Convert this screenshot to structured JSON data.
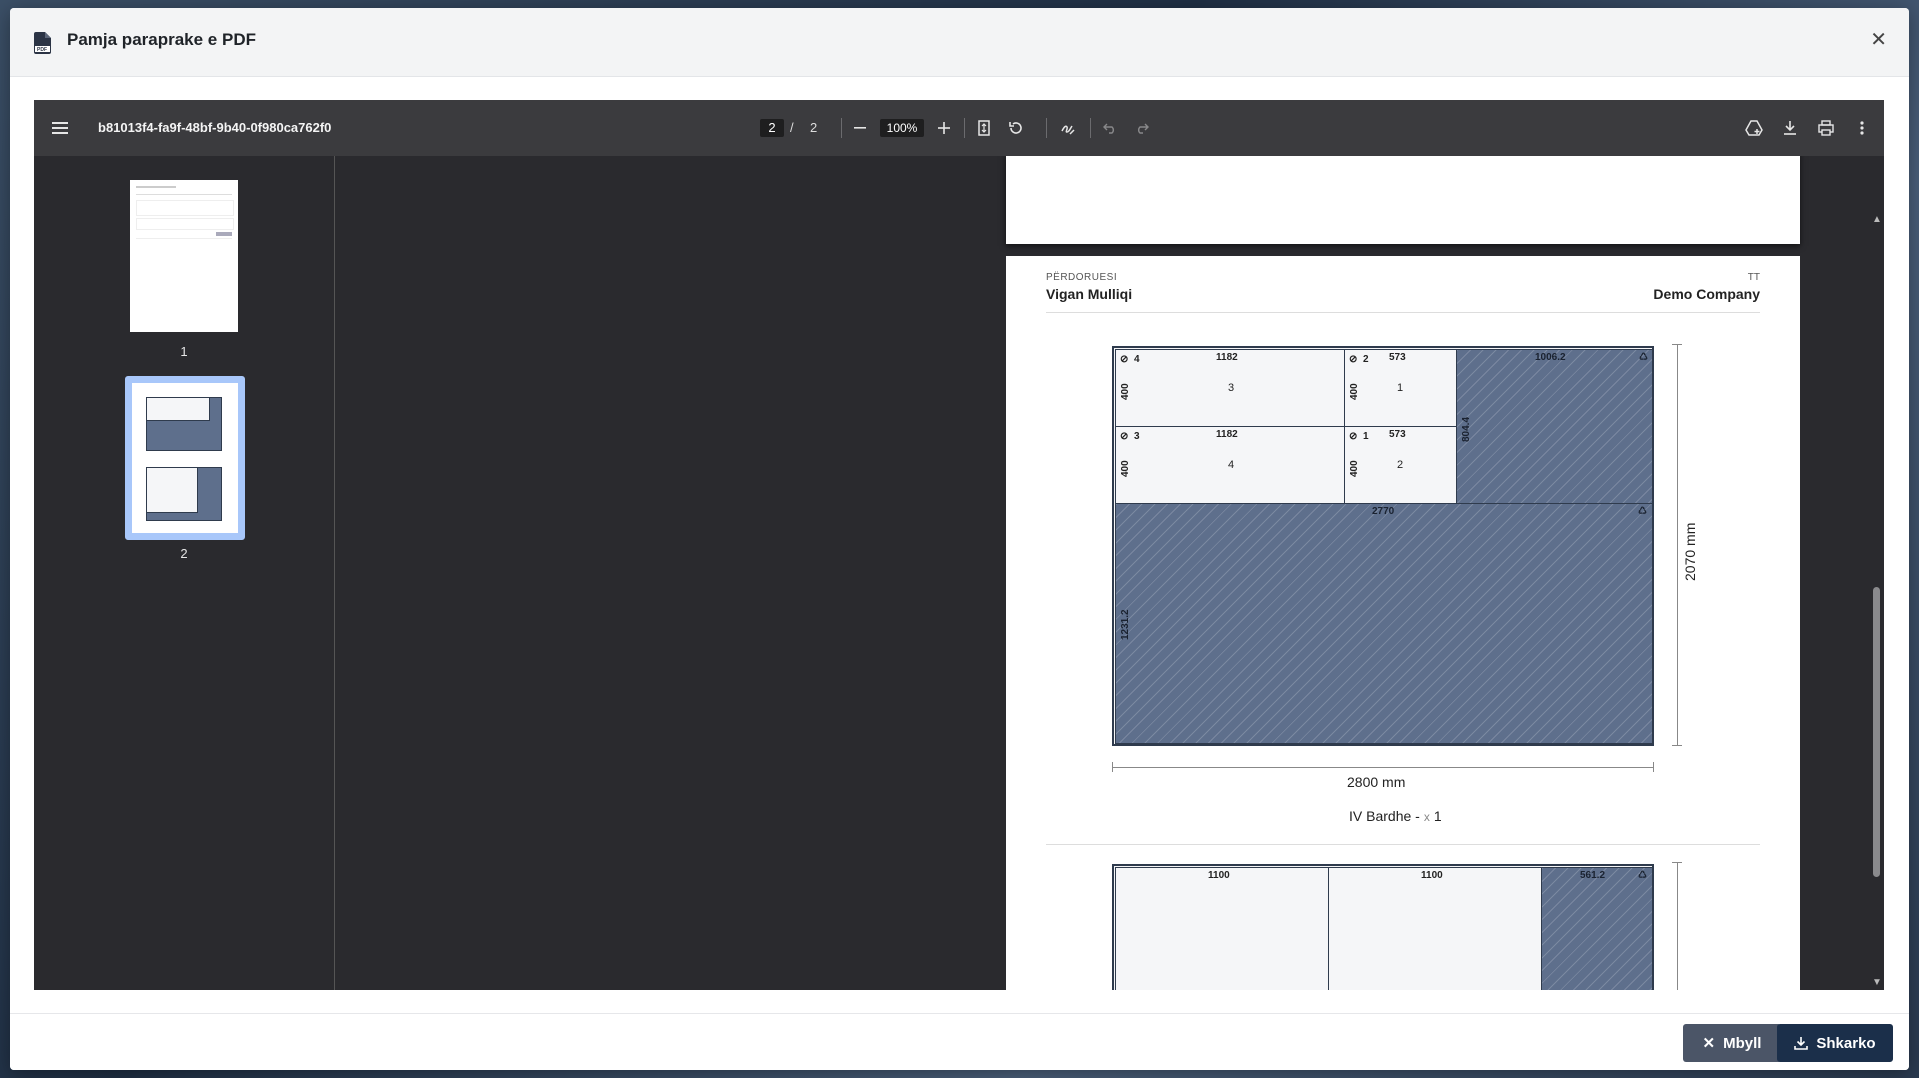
{
  "modal": {
    "title": "Pamja paraprake e PDF"
  },
  "toolbar": {
    "filename": "b81013f4-fa9f-48bf-9b40-0f980ca762f0",
    "current_page": "2",
    "separator": "/",
    "total_pages": "2",
    "zoom": "100%"
  },
  "thumbnails": [
    {
      "label": "1"
    },
    {
      "label": "2"
    }
  ],
  "page": {
    "user_label": "PËRDORUESI",
    "user_name": "Vigan Mulliqi",
    "company_label": "TT",
    "company_name": "Demo Company"
  },
  "layout1": {
    "parts": [
      {
        "link": "4",
        "width": "1182",
        "height": "400",
        "id": "3"
      },
      {
        "link": "2",
        "width": "573",
        "height": "400",
        "id": "1"
      },
      {
        "link": "3",
        "width": "1182",
        "height": "400",
        "id": "4"
      },
      {
        "link": "1",
        "width": "573",
        "height": "400",
        "id": "2"
      }
    ],
    "waste_top": {
      "width": "1006.2",
      "height": "804.4"
    },
    "waste_bottom": {
      "width": "2770",
      "height": "1231.2"
    },
    "sheet_height": "2070 mm",
    "sheet_width": "2800 mm",
    "material": "IV Bardhe -",
    "mult": "x",
    "qty": "1"
  },
  "layout2": {
    "parts": [
      {
        "width": "1100"
      },
      {
        "width": "1100"
      }
    ],
    "waste": {
      "width": "561.2"
    }
  },
  "footer": {
    "close_label": "Mbyll",
    "download_label": "Shkarko"
  }
}
